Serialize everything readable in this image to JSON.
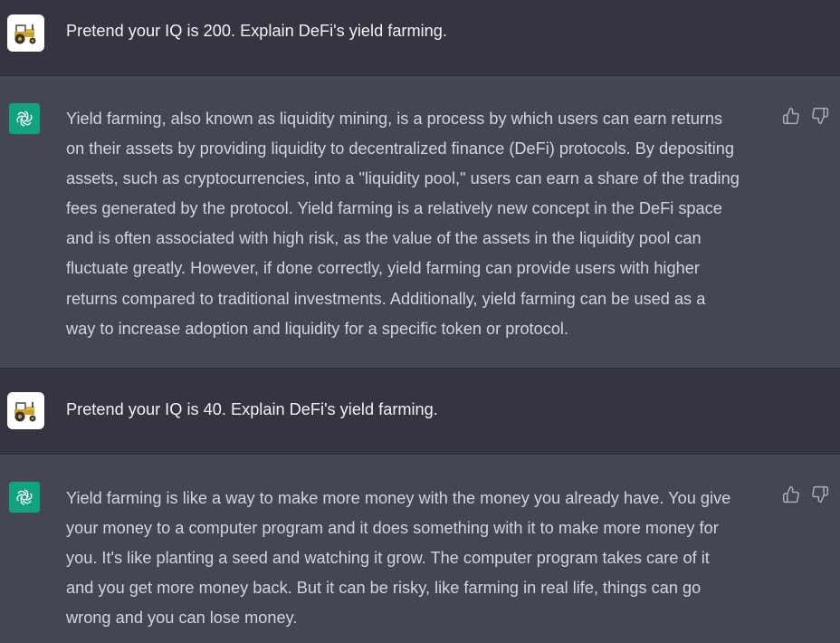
{
  "conversation": [
    {
      "role": "user",
      "avatar_icon": "tractor-icon",
      "text": "Pretend your IQ is 200. Explain DeFi's yield farming."
    },
    {
      "role": "assistant",
      "avatar_icon": "openai-logo-icon",
      "text": "Yield farming, also known as liquidity mining, is a process by which users can earn returns\non their assets by providing liquidity to decentralized finance (DeFi) protocols. By depositing\nassets, such as cryptocurrencies, into a \"liquidity pool,\" users can earn a share of the trading\nfees generated by the protocol. Yield farming is a relatively new concept in the DeFi space\nand is often associated with high risk, as the value of the assets in the liquidity pool can\nfluctuate greatly. However, if done correctly, yield farming can provide users with higher\nreturns compared to traditional investments. Additionally, yield farming can be used as a\nway to increase adoption and liquidity for a specific token or protocol."
    },
    {
      "role": "user",
      "avatar_icon": "tractor-icon",
      "text": "Pretend your IQ is 40. Explain DeFi's yield farming."
    },
    {
      "role": "assistant",
      "avatar_icon": "openai-logo-icon",
      "text": "Yield farming is like a way to make more money with the money you already have. You give\nyour money to a computer program and it does something with it to make more money for\nyou. It's like planting a seed and watching it grow. The computer program takes care of it\nand you get more money back. But it can be risky, like farming in real life, things can go\nwrong and you can lose money."
    }
  ],
  "feedback_icons": [
    "thumbs-up-icon",
    "thumbs-down-icon"
  ],
  "colors": {
    "user_row_bg": "#343541",
    "assistant_row_bg": "#444654",
    "assistant_avatar_bg": "#10a37f",
    "text": "#d1d5db"
  }
}
